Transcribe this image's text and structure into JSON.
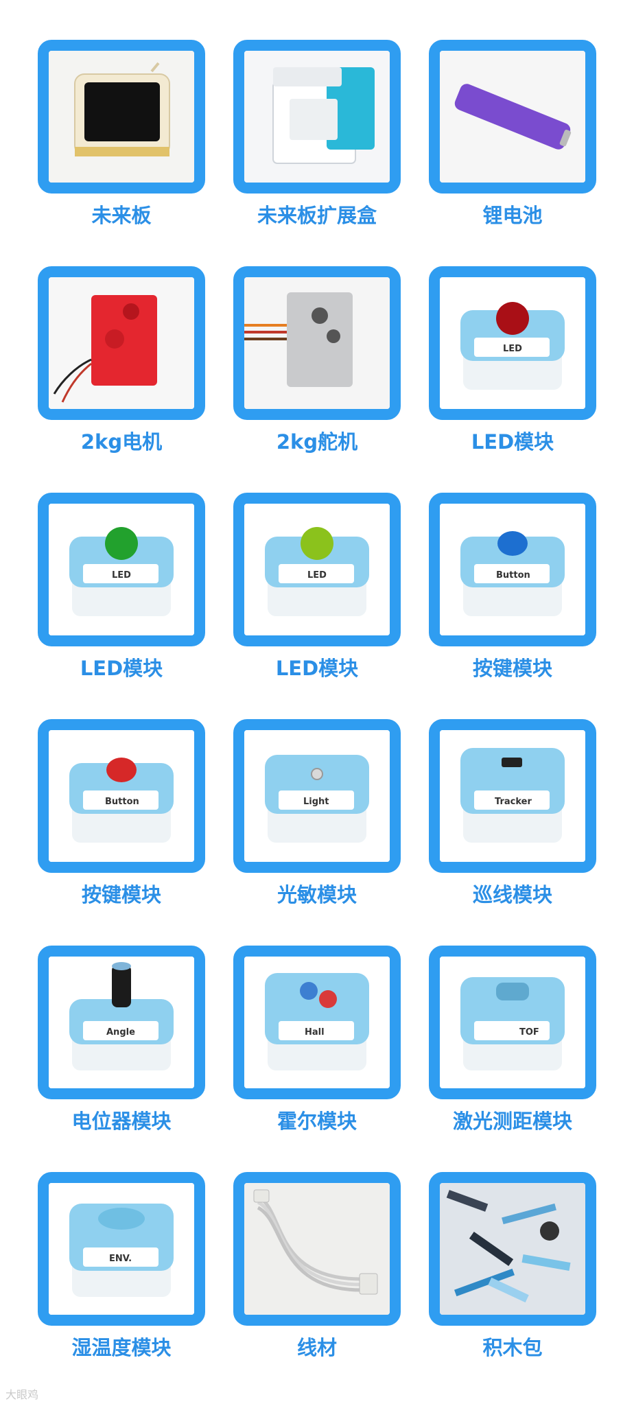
{
  "items": [
    {
      "label": "未来板",
      "icon": "future-board-image"
    },
    {
      "label": "未来板扩展盒",
      "icon": "expansion-box-image"
    },
    {
      "label": "锂电池",
      "icon": "lithium-battery-image"
    },
    {
      "label": "2kg电机",
      "icon": "motor-image"
    },
    {
      "label": "2kg舵机",
      "icon": "servo-image"
    },
    {
      "label": "LED模块",
      "icon": "led-red-module-image"
    },
    {
      "label": "LED模块",
      "icon": "led-green-module-image"
    },
    {
      "label": "LED模块",
      "icon": "led-yellow-green-module-image"
    },
    {
      "label": "按键模块",
      "icon": "button-blue-module-image"
    },
    {
      "label": "按键模块",
      "icon": "button-red-module-image"
    },
    {
      "label": "光敏模块",
      "icon": "light-sensor-module-image"
    },
    {
      "label": "巡线模块",
      "icon": "tracker-module-image"
    },
    {
      "label": "电位器模块",
      "icon": "potentiometer-module-image"
    },
    {
      "label": "霍尔模块",
      "icon": "hall-module-image"
    },
    {
      "label": "激光测距模块",
      "icon": "laser-distance-module-image"
    },
    {
      "label": "湿温度模块",
      "icon": "humidity-temperature-module-image"
    },
    {
      "label": "线材",
      "icon": "cable-image"
    },
    {
      "label": "积木包",
      "icon": "building-blocks-pack-image"
    }
  ],
  "module_tags": {
    "led": "LED",
    "button": "Button",
    "light": "Light",
    "tracker": "Tracker",
    "angle": "Angle",
    "hall": "Hall",
    "tof": "TOF",
    "env": "ENV."
  },
  "watermark": "大眼鸡",
  "colors": {
    "frame": "#2f9df1",
    "label": "#2b8fe6",
    "module_body": "#8fd0ef"
  }
}
